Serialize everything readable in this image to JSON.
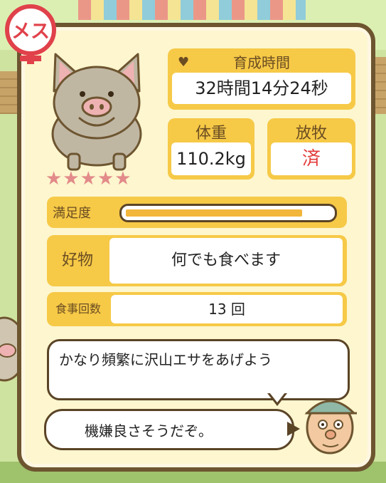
{
  "badge": {
    "label": "メス"
  },
  "pig": {
    "stars": "★★★★★",
    "star_count": 5
  },
  "time": {
    "label": "育成時間",
    "value": "32時間14分24秒"
  },
  "weight": {
    "label": "体重",
    "value": "110.2kg"
  },
  "graze": {
    "label": "放牧",
    "value": "済"
  },
  "satisfaction": {
    "label": "満足度",
    "level": 0.86
  },
  "favorite": {
    "label": "好物",
    "value": "何でも食べます"
  },
  "meals": {
    "label": "食事回数",
    "value": "13 回"
  },
  "speech": {
    "advice": "かなり頻繁に沢山エサをあげよう",
    "mood": "機嫌良さそうだぞ。"
  },
  "colors": {
    "accent": "#f6c947",
    "frame": "#6d5530",
    "badge": "#e0414a",
    "graze_text": "#e23b3b"
  }
}
